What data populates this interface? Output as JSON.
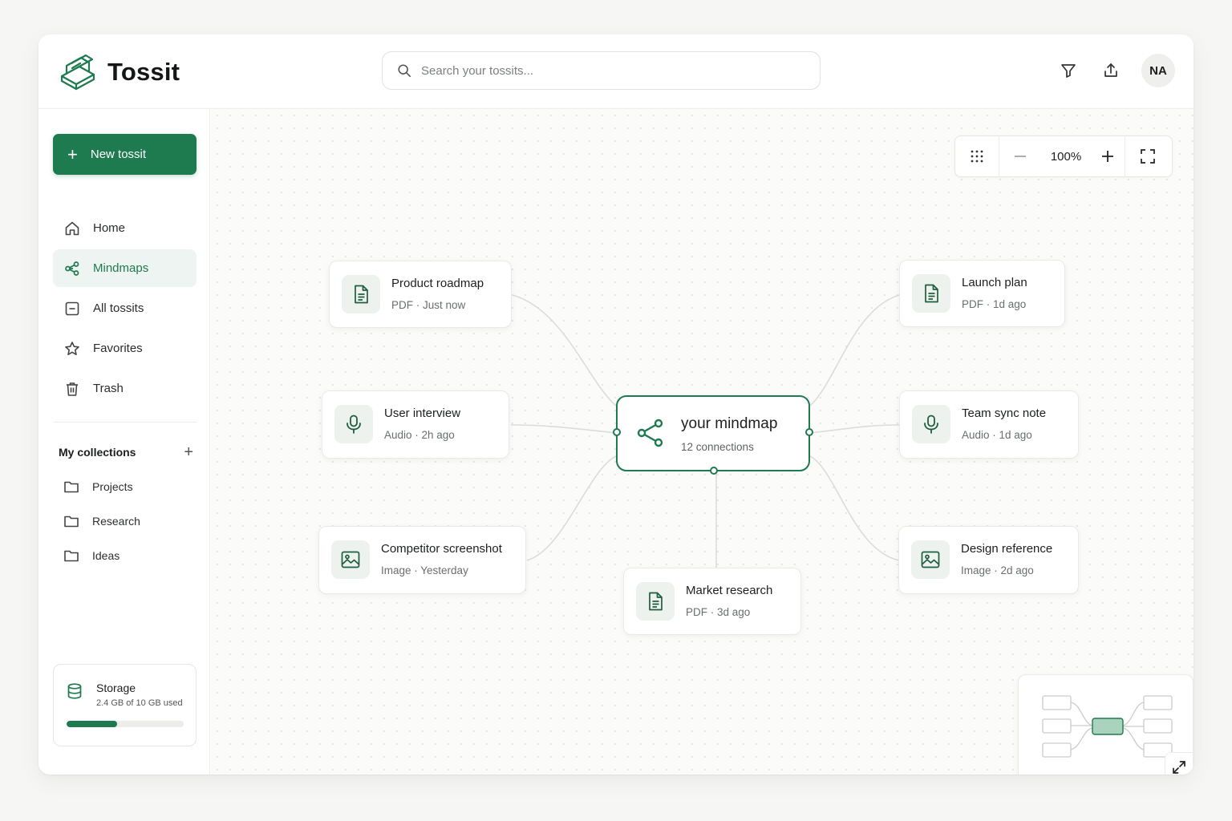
{
  "app": {
    "name": "Tossit",
    "logo_icon": "open-box-icon"
  },
  "search": {
    "placeholder": "Search your tossits...",
    "value": ""
  },
  "header": {
    "filter_icon": "filter-icon",
    "share_icon": "upload-icon",
    "avatar_initials": "NA"
  },
  "sidebar": {
    "new_button": "New tossit",
    "nav": [
      {
        "label": "Home",
        "icon": "home-icon"
      },
      {
        "label": "Mindmaps",
        "icon": "share-graph-icon",
        "active": true
      },
      {
        "label": "All tossits",
        "icon": "box-icon"
      },
      {
        "label": "Favorites",
        "icon": "star-icon"
      },
      {
        "label": "Trash",
        "icon": "trash-icon"
      }
    ],
    "collections_title": "My collections",
    "collections": [
      {
        "label": "Projects"
      },
      {
        "label": "Research"
      },
      {
        "label": "Ideas"
      }
    ],
    "storage": {
      "title": "Storage",
      "usage": "2.4 GB of 10 GB used",
      "fraction": 0.43
    }
  },
  "zoom": {
    "level": "100%"
  },
  "mindmap": {
    "center": {
      "title": "your mindmap",
      "meta": "12 connections"
    },
    "nodes": [
      {
        "title": "Product roadmap",
        "meta": "PDF · Just now",
        "type": "document"
      },
      {
        "title": "User interview",
        "meta": "Audio · 2h ago",
        "type": "audio"
      },
      {
        "title": "Competitor screenshot",
        "meta": "Image · Yesterday",
        "type": "image"
      },
      {
        "title": "Market research",
        "meta": "PDF · 3d ago",
        "type": "document"
      },
      {
        "title": "Launch plan",
        "meta": "PDF · 1d ago",
        "type": "document"
      },
      {
        "title": "Team sync note",
        "meta": "Audio · 1d ago",
        "type": "audio"
      },
      {
        "title": "Design reference",
        "meta": "Image · 2d ago",
        "type": "image"
      }
    ]
  },
  "colors": {
    "accent": "#1e7a4f",
    "accent_light": "#eef4f1",
    "icon_bg": "#eef2ef"
  }
}
